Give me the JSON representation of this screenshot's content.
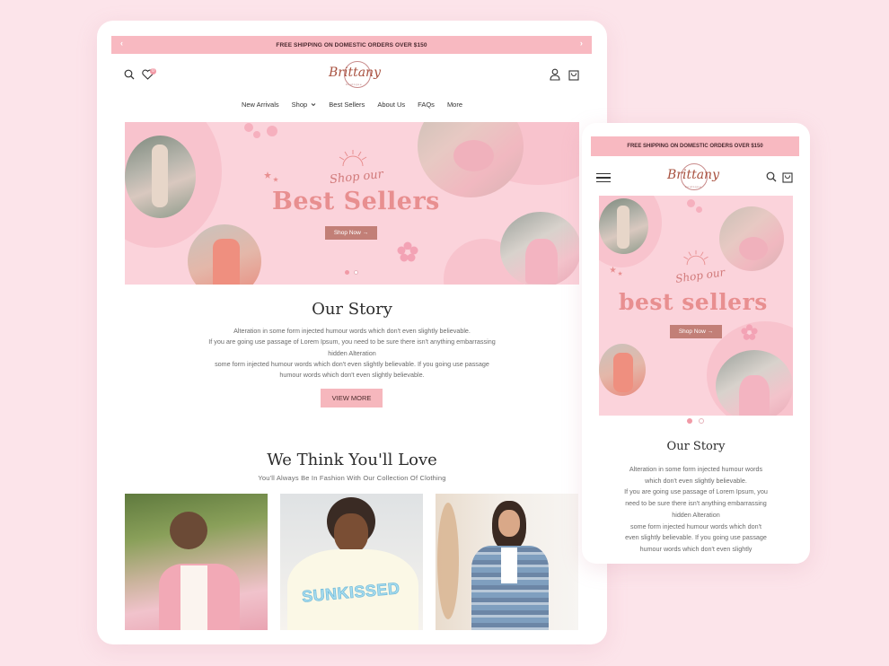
{
  "desktop": {
    "shipping_banner": "FREE SHIPPING ON DOMESTIC ORDERS OVER $150",
    "arrow_left": "‹",
    "arrow_right": "›",
    "wishlist_count": "0",
    "logo": {
      "name": "Brittany",
      "subtitle": "boutique"
    },
    "nav": [
      "New Arrivals",
      "Shop",
      "Best Sellers",
      "About Us",
      "FAQs",
      "More"
    ],
    "hero": {
      "script": "Shop our",
      "title": "Best Sellers",
      "button": "Shop Now →"
    },
    "story": {
      "title": "Our Story",
      "lines": [
        "Alteration in some form injected humour words which don't even slightly believable.",
        "If you are going use passage of Lorem Ipsum, you need to be sure there isn't anything embarrassing",
        "hidden Alteration",
        "some form injected humour words which don't even slightly believable. If you going use passage",
        "humour words which don't even slightly believable."
      ],
      "button": "VIEW MORE"
    },
    "love": {
      "title": "We Think You'll Love",
      "subtitle": "You'll Always Be In Fashion With Our Collection Of Clothing",
      "shirt_text": "SUNKISSED"
    }
  },
  "mobile": {
    "shipping_banner": "FREE SHIPPING ON DOMESTIC ORDERS OVER $150",
    "logo": {
      "name": "Brittany",
      "subtitle": "boutique"
    },
    "hero": {
      "script": "Shop our",
      "title": "best sellers",
      "button": "Shop Now →"
    },
    "story": {
      "title": "Our Story",
      "lines": [
        "Alteration in some form injected humour words",
        "which don't even slightly believable.",
        "If you are going use passage of Lorem Ipsum, you",
        "need to be sure there isn't anything embarrassing",
        "hidden Alteration",
        "some form injected humour words which don't",
        "even slightly believable. If you going use passage",
        "humour words which don't even slightly"
      ]
    }
  },
  "colors": {
    "page_bg": "#fce4ea",
    "banner": "#f8b9c1",
    "hero_bg": "#fbd3db",
    "hero_title": "#e88f90",
    "button_mauve": "#c27f77",
    "view_more": "#f6b7bd",
    "active_dot": "#f19aa6"
  },
  "icons": [
    "search-icon",
    "heart-icon",
    "user-icon",
    "shopping-bag-icon",
    "hamburger-menu-icon",
    "chevron-down-icon",
    "arrow-left-icon",
    "arrow-right-icon"
  ]
}
